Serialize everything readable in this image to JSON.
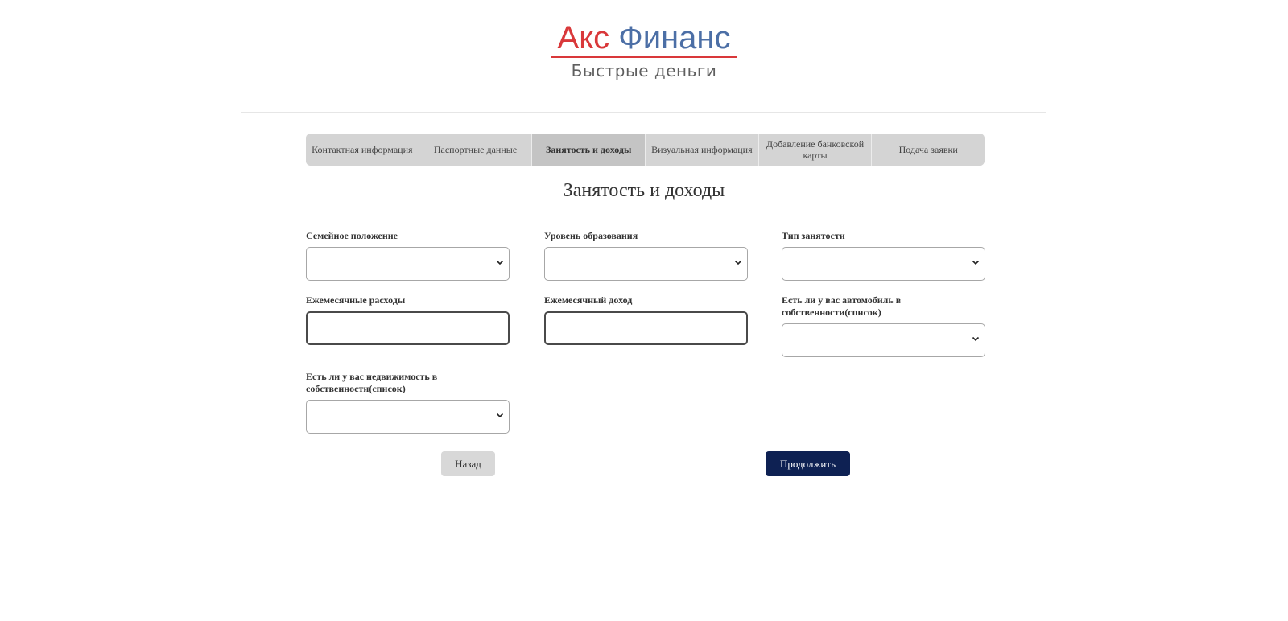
{
  "logo": {
    "word1": "Акс",
    "word2": "Финанс",
    "tagline": "Быстрые деньги",
    "color_primary": "#d9383a",
    "color_secondary": "#4c6fa6"
  },
  "steps": [
    {
      "label": "Контактная информация",
      "active": false
    },
    {
      "label": "Паспортные данные",
      "active": false
    },
    {
      "label": "Занятость и доходы",
      "active": true
    },
    {
      "label": "Визуальная информация",
      "active": false
    },
    {
      "label": "Добавление банковской карты",
      "active": false
    },
    {
      "label": "Подача заявки",
      "active": false
    }
  ],
  "page": {
    "title": "Занятость и доходы"
  },
  "form": {
    "marital_status": {
      "label": "Семейное положение",
      "value": ""
    },
    "education_level": {
      "label": "Уровень образования",
      "value": ""
    },
    "employment_type": {
      "label": "Тип занятости",
      "value": ""
    },
    "monthly_expenses": {
      "label": "Ежемесячные расходы",
      "value": ""
    },
    "monthly_income": {
      "label": "Ежемесячный доход",
      "value": ""
    },
    "car_ownership": {
      "label": "Есть ли у вас автомобиль в собственности(список)",
      "value": ""
    },
    "property_ownership": {
      "label": "Есть ли у вас недвижимость в собственности(список)",
      "value": ""
    }
  },
  "buttons": {
    "back": "Назад",
    "continue": "Продолжить",
    "continue_color": "#0e2153"
  },
  "icons": {
    "select_arrow": "chevron-down-icon"
  }
}
